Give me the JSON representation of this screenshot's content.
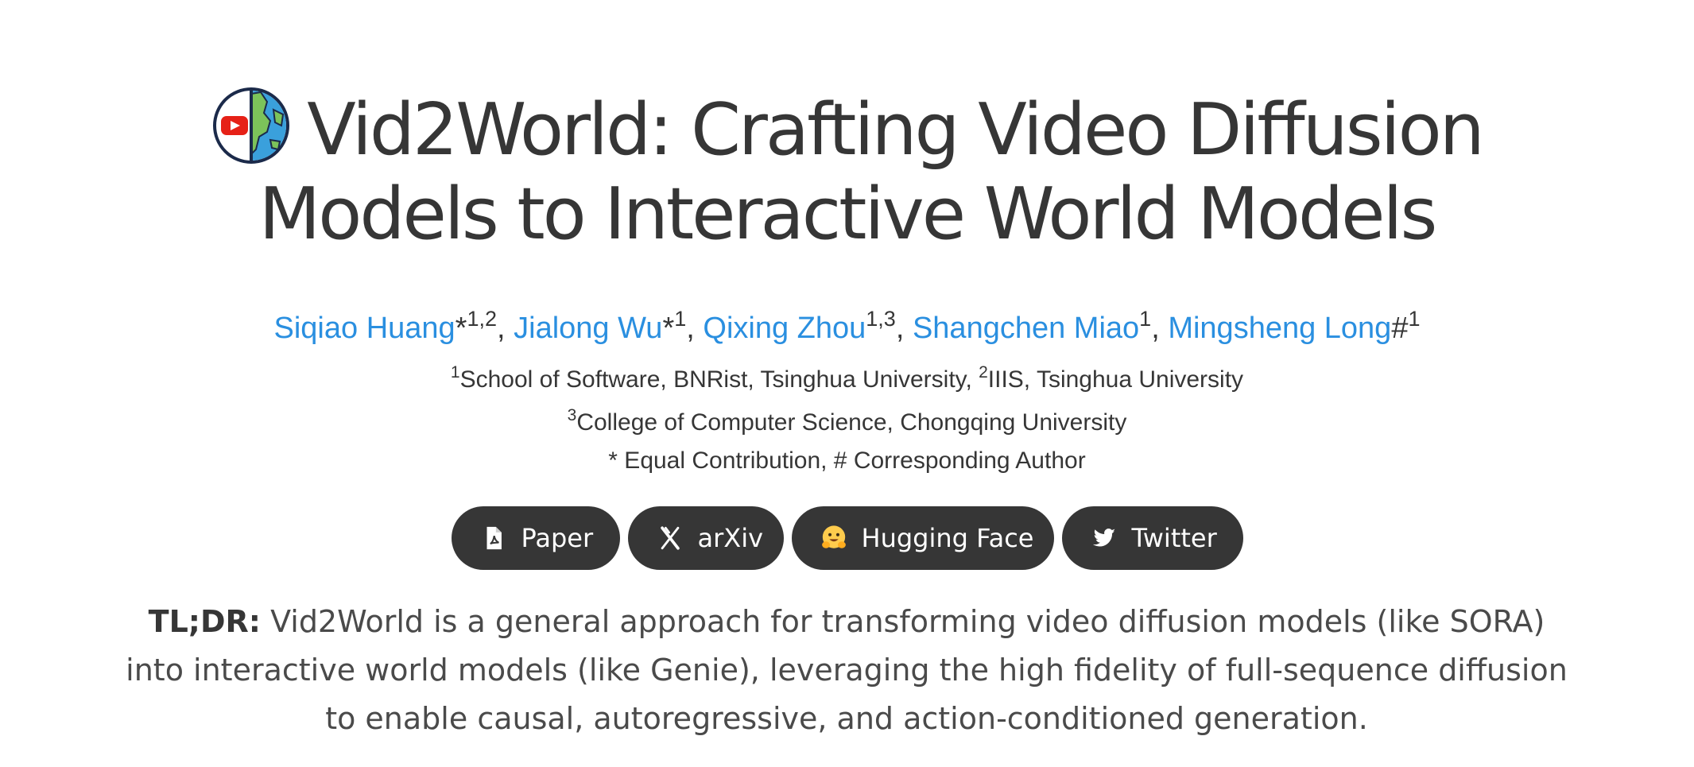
{
  "title": {
    "line1": "Vid2World: Crafting Video Diffusion",
    "line2": "Models to Interactive World Models",
    "logo_icon": "youtube-globe-icon"
  },
  "authors": [
    {
      "name": "Siqiao Huang",
      "mark": "*",
      "sup": "1,2",
      "sep": ", "
    },
    {
      "name": "Jialong Wu",
      "mark": "*",
      "sup": "1",
      "sep": ", "
    },
    {
      "name": "Qixing Zhou",
      "mark": "",
      "sup": "1,3",
      "sep": ", "
    },
    {
      "name": "Shangchen Miao",
      "mark": "",
      "sup": "1",
      "sep": ", "
    },
    {
      "name": "Mingsheng Long",
      "mark": "#",
      "sup": "1",
      "sep": ""
    }
  ],
  "affiliations": {
    "line1": {
      "sup_a": "1",
      "text_a": "School of Software, BNRist, Tsinghua University, ",
      "sup_b": "2",
      "text_b": "IIIS, Tsinghua University"
    },
    "line2": {
      "sup": "3",
      "text": "College of Computer Science, Chongqing University"
    },
    "note": "* Equal Contribution, # Corresponding Author"
  },
  "buttons": [
    {
      "label": "Paper",
      "icon": "pdf-file-icon"
    },
    {
      "label": "arXiv",
      "icon": "arxiv-icon"
    },
    {
      "label": "Hugging Face",
      "icon": "hugging-face-emoji-icon"
    },
    {
      "label": "Twitter",
      "icon": "twitter-bird-icon"
    }
  ],
  "tldr": {
    "label": "TL;DR:",
    "text": " Vid2World is a general approach for transforming video diffusion models (like SORA) into interactive world models (like Genie), leveraging the high fidelity of full-sequence diffusion to enable causal, autoregressive, and action-conditioned generation."
  },
  "colors": {
    "text": "#363636",
    "link": "#2a8fe0",
    "button_bg": "#363636",
    "button_text": "#ffffff"
  }
}
